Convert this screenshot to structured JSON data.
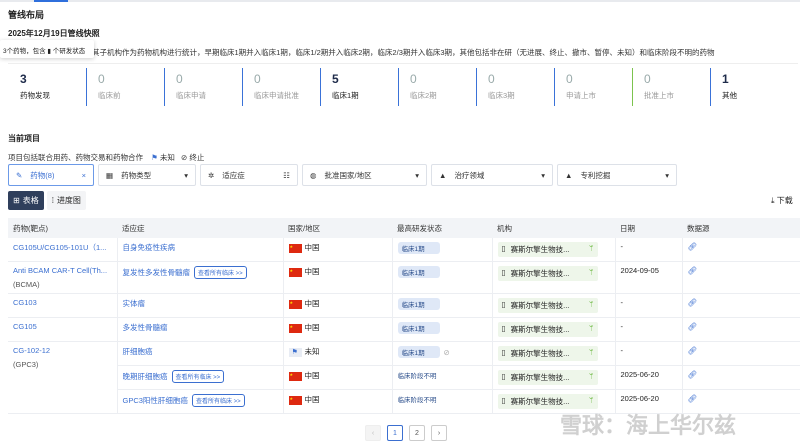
{
  "section_title": "管线布局",
  "snapshot_title": "2025年12月19日管线快照",
  "description": "以机构及其子机构作为药物机构进行统计，早期临床1期并入临床1期，临床1/2期并入临床2期，临床2/3期并入临床3期，其他包括非在研（无进展、终止、撤市、暂停、未知）和临床阶段不明的药物",
  "tooltip": "3个药物，包含 ▮ 个研发状态",
  "stages": [
    {
      "count": "3",
      "label": "药物发现"
    },
    {
      "count": "0",
      "label": "临床前"
    },
    {
      "count": "0",
      "label": "临床申请"
    },
    {
      "count": "0",
      "label": "临床申请批准"
    },
    {
      "count": "5",
      "label": "临床1期"
    },
    {
      "count": "0",
      "label": "临床2期"
    },
    {
      "count": "0",
      "label": "临床3期"
    },
    {
      "count": "0",
      "label": "申请上市"
    },
    {
      "count": "0",
      "label": "批准上市"
    },
    {
      "count": "1",
      "label": "其他"
    }
  ],
  "current_title": "当前项目",
  "current_desc": "项目包括联合用药、药物交易和药物合作",
  "legend_unknown": "未知",
  "legend_stop": "终止",
  "filters": [
    "药物(8)",
    "药物类型",
    "适应症",
    "批准国家/地区",
    "治疗领域",
    "专利挖掘"
  ],
  "tabs": {
    "table": "表格",
    "progress": "进度图"
  },
  "download": "下载",
  "columns": [
    "药物(靶点)",
    "适应症",
    "国家/地区",
    "最高研发状态",
    "机构",
    "日期",
    "数据源"
  ],
  "rows": [
    {
      "drug": "CG105U/CG105-101U（1...",
      "target": "",
      "ind": "自身免疫性疾病",
      "all": "",
      "country": "中国",
      "status": "临床1期",
      "org": "赛斯尔擎生物技...",
      "date": "-"
    },
    {
      "drug": "Anti BCAM CAR-T Cell(Th...",
      "target": "(BCMA)",
      "ind": "复发性多发性骨髓瘤",
      "all": "查看所有临床 >>",
      "country": "中国",
      "status": "临床1期",
      "org": "赛斯尔擎生物技...",
      "date": "2024-09-05"
    },
    {
      "drug": "CG103",
      "target": "",
      "ind": "实体瘤",
      "all": "",
      "country": "中国",
      "status": "临床1期",
      "org": "赛斯尔擎生物技...",
      "date": "-"
    },
    {
      "drug": "CG105",
      "target": "",
      "ind": "多发性骨髓瘤",
      "all": "",
      "country": "中国",
      "status": "临床1期",
      "org": "赛斯尔擎生物技...",
      "date": "-"
    },
    {
      "drug": "CG-102-12",
      "target": "(GPC3)",
      "ind": "肝细胞癌",
      "all": "",
      "country": "未知",
      "status": "临床1期",
      "org": "赛斯尔擎生物技...",
      "date": "-"
    },
    {
      "drug": "",
      "target": "",
      "ind": "晚期肝细胞癌",
      "all": "查看所有临床 >>",
      "country": "中国",
      "status": "临床阶段不明",
      "org": "赛斯尔擎生物技...",
      "date": "2025-06-20"
    },
    {
      "drug": "",
      "target": "",
      "ind": "GPC3阳性肝细胞癌",
      "all": "查看所有临床 >>",
      "country": "中国",
      "status": "临床阶段不明",
      "org": "赛斯尔擎生物技...",
      "date": "2025-06-20"
    }
  ],
  "pagination": {
    "pages": [
      "1",
      "2"
    ],
    "prev": "‹",
    "next": "›"
  },
  "watermark": "雪球：海上华尔兹"
}
